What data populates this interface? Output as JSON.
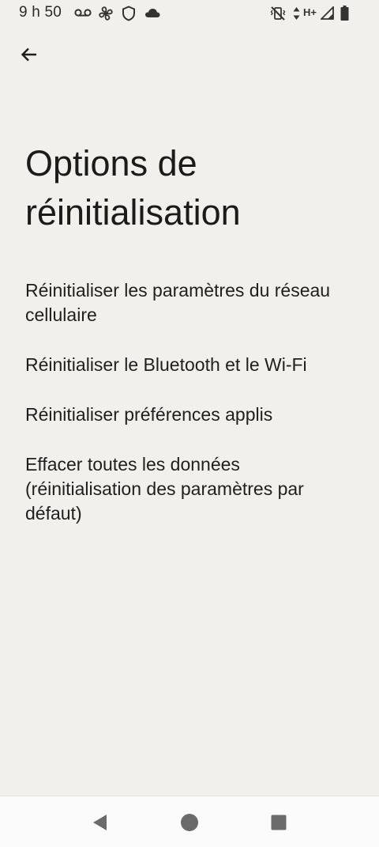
{
  "status_bar": {
    "time": "9 h 50",
    "network_type": "H+",
    "icons": [
      "voicemail-icon",
      "fan-icon",
      "shield-icon",
      "cloud-icon",
      "vibrate-off-icon",
      "data-arrows-icon",
      "signal-icon",
      "battery-icon"
    ]
  },
  "header": {
    "back_icon": "arrow-left-icon",
    "title": "Options de réinitialisation"
  },
  "options": [
    {
      "label": "Réinitialiser les paramètres du réseau cellulaire"
    },
    {
      "label": "Réinitialiser le Bluetooth et le Wi-Fi"
    },
    {
      "label": "Réinitialiser préférences applis"
    },
    {
      "label": "Effacer toutes les données (réinitialisation des paramètres par défaut)"
    }
  ],
  "nav_bar": {
    "icons": [
      "back-triangle-icon",
      "home-circle-icon",
      "recents-square-icon"
    ]
  },
  "colors": {
    "background": "#f1f0ec",
    "text": "#1f1f1f",
    "nav_background": "#fbfbfb",
    "nav_icon": "#6b6b6b"
  }
}
